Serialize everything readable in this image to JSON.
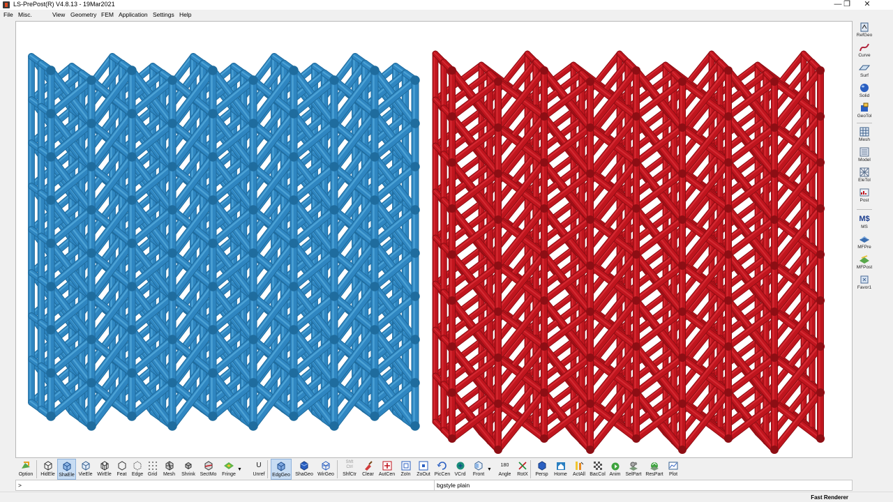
{
  "window": {
    "title": "LS-PrePost(R) V4.8.13 - 19Mar2021",
    "controls": [
      "—",
      "❐",
      "✕"
    ]
  },
  "menu": [
    "File",
    "Misc.",
    "View",
    "Geometry",
    "FEM",
    "Application",
    "Settings",
    "Help"
  ],
  "viewport": {
    "background": "#ffffff",
    "models": [
      {
        "name": "blue-lattice-part",
        "color": "#2f86c1",
        "shade": "#1f6c9e",
        "highlight": "#5ab0e0"
      },
      {
        "name": "red-lattice-part",
        "color": "#c0151e",
        "shade": "#8e0e14",
        "highlight": "#e0343c"
      }
    ]
  },
  "right_toolbar": [
    {
      "label": "RefGeo",
      "icon": "refgeo-icon"
    },
    {
      "label": "Curve",
      "icon": "curve-icon"
    },
    {
      "label": "Surf",
      "icon": "surface-icon"
    },
    {
      "label": "Solid",
      "icon": "solid-icon"
    },
    {
      "label": "GeoTol",
      "icon": "geotol-icon"
    },
    {
      "label": "Mesh",
      "icon": "mesh-icon"
    },
    {
      "label": "Model",
      "icon": "model-icon"
    },
    {
      "label": "EleTol",
      "icon": "eletol-icon"
    },
    {
      "label": "Post",
      "icon": "post-icon"
    },
    {
      "label": "MS",
      "icon": "ms-icon",
      "glyph": "M$"
    },
    {
      "label": "MFPre",
      "icon": "mfpre-icon"
    },
    {
      "label": "MFPost",
      "icon": "mfpost-icon"
    },
    {
      "label": "Favor1",
      "icon": "favorite-icon"
    }
  ],
  "bottom_toolbar": [
    {
      "label": "Option",
      "icon": "option-icon"
    },
    {
      "label": "HidEle",
      "icon": "hidden-element-icon"
    },
    {
      "label": "ShaEle",
      "icon": "shaded-element-icon",
      "active": true
    },
    {
      "label": "VieEle",
      "icon": "view-element-icon"
    },
    {
      "label": "WirEle",
      "icon": "wire-element-icon"
    },
    {
      "label": "Feat",
      "icon": "feature-icon"
    },
    {
      "label": "Edge",
      "icon": "edge-icon"
    },
    {
      "label": "Grid",
      "icon": "grid-icon"
    },
    {
      "label": "Mesh",
      "icon": "mesh-view-icon"
    },
    {
      "label": "Shrink",
      "icon": "shrink-icon"
    },
    {
      "label": "SectMo",
      "icon": "section-mode-icon"
    },
    {
      "label": "Fringe",
      "icon": "fringe-icon"
    },
    {
      "label": "Unref",
      "icon": "unref-icon",
      "glyph": "U"
    },
    {
      "label": "EdgGeo",
      "icon": "edge-geometry-icon",
      "active": true
    },
    {
      "label": "ShaGeo",
      "icon": "shaded-geometry-icon"
    },
    {
      "label": "WirGeo",
      "icon": "wire-geometry-icon"
    },
    {
      "label": "ShfCtr",
      "icon": "shift-ctrl-icon",
      "glyph": "Shft Ctrl"
    },
    {
      "label": "Clear",
      "icon": "clear-icon"
    },
    {
      "label": "AutCen",
      "icon": "auto-center-icon"
    },
    {
      "label": "ZoIn",
      "icon": "zoom-in-icon"
    },
    {
      "label": "ZoOut",
      "icon": "zoom-out-icon"
    },
    {
      "label": "PicCen",
      "icon": "pick-center-icon"
    },
    {
      "label": "VCrd",
      "icon": "view-coordinate-icon"
    },
    {
      "label": "Front",
      "icon": "front-view-icon"
    },
    {
      "label": "Angle",
      "icon": "angle-icon",
      "glyph": "180"
    },
    {
      "label": "RotX",
      "icon": "rotate-x-icon"
    },
    {
      "label": "Persp",
      "icon": "perspective-icon"
    },
    {
      "label": "Home",
      "icon": "home-icon"
    },
    {
      "label": "ActAll",
      "icon": "activate-all-icon"
    },
    {
      "label": "BacCol",
      "icon": "background-color-icon"
    },
    {
      "label": "Anim",
      "icon": "animation-icon"
    },
    {
      "label": "SelPart",
      "icon": "select-part-icon"
    },
    {
      "label": "ResPart",
      "icon": "restore-part-icon"
    },
    {
      "label": "Plot",
      "icon": "plot-icon"
    }
  ],
  "command": {
    "prompt": ">",
    "message": "bgstyle plain"
  },
  "status": {
    "renderer": "Fast Renderer"
  },
  "colors": {
    "active_button_bg": "#c7dcf3",
    "active_button_border": "#8fb3dc"
  }
}
